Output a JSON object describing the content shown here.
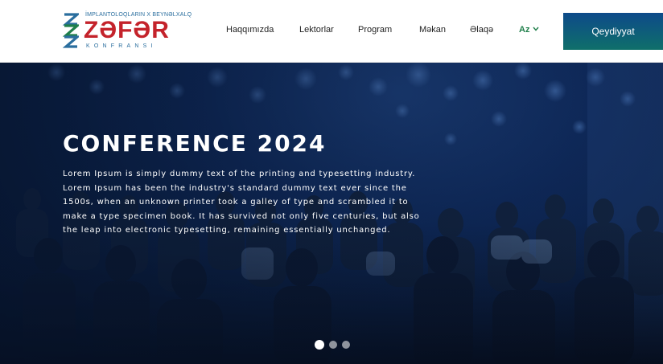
{
  "logo": {
    "top_line": "İMPLANTOLOQLARIN X BEYNƏLXALQ",
    "main": "ZƏFƏR",
    "bottom_line": "KONFRANSI",
    "colors": {
      "red": "#c4232b",
      "blue": "#2a6e9e",
      "green": "#1f7f4a"
    }
  },
  "nav": {
    "items": [
      "Haqqımızda",
      "Lektorlar",
      "Program",
      "Məkan",
      "Əlaqə"
    ],
    "language": "Az",
    "language_icon": "chevron-down-icon"
  },
  "header": {
    "register_label": "Qeydiyyat"
  },
  "hero": {
    "title": "CONFERENCE 2024",
    "text": "Lorem Ipsum is simply dummy text of the printing and typesetting industry. Lorem Ipsum has been the industry's standard dummy text ever since the 1500s, when an unknown printer took a galley of type and scrambled it to make a type specimen book. It has survived not only five centuries, but also the leap into electronic typesetting, remaining essentially unchanged.",
    "slides": 3,
    "active_slide": 1
  }
}
